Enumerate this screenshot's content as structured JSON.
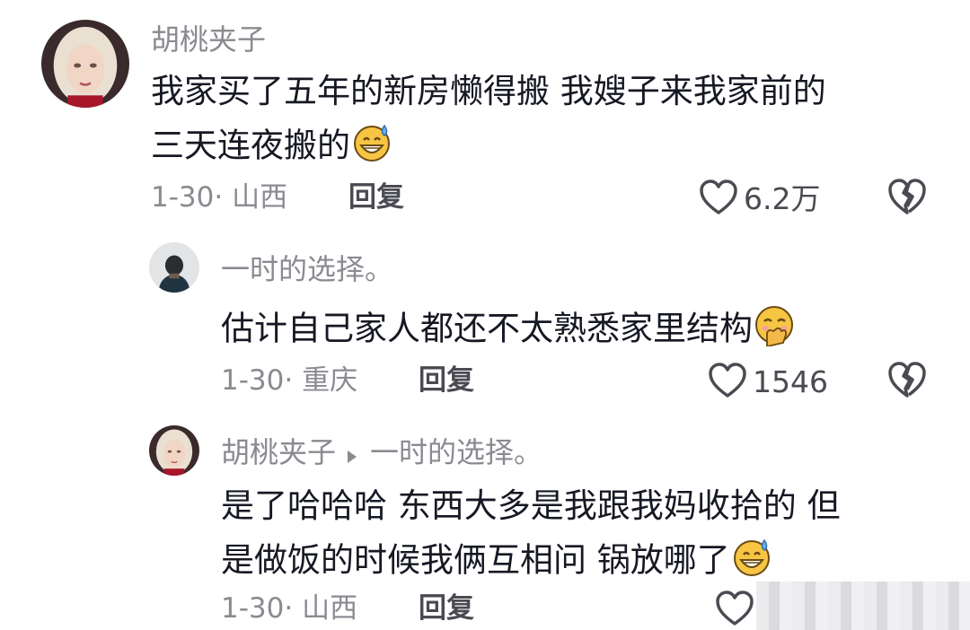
{
  "comments": [
    {
      "username": "胡桃夹子",
      "lines": [
        "我家买了五年的新房懒得搬 我嫂子来我家前的",
        "三天连夜搬的"
      ],
      "meta": "1-30· 山西",
      "reply_label": "回复",
      "likes": "6.2万",
      "avatar": "avatar-blonde-woman",
      "emoji": "grinning-sweat-emoji"
    },
    {
      "username": "一时的选择。",
      "lines": [
        "估计自己家人都还不太熟悉家里结构"
      ],
      "meta": "1-30· 重庆",
      "reply_label": "回复",
      "likes": "1546",
      "avatar": "avatar-dark-figure",
      "emoji": "hand-over-mouth-emoji"
    },
    {
      "username": "胡桃夹子",
      "reply_to": "一时的选择。",
      "lines": [
        "是了哈哈哈 东西大多是我跟我妈收拾的 但",
        "是做饭的时候我俩互相问 锅放哪了"
      ],
      "meta": "1-30· 山西",
      "reply_label": "回复",
      "avatar": "avatar-blonde-woman",
      "emoji": "grinning-sweat-emoji"
    }
  ],
  "icons": {
    "like": "heart-outline-icon",
    "dislike": "broken-heart-icon",
    "reply_arrow": "triangle-right-icon"
  },
  "colors": {
    "text": "#161823",
    "muted": "#8a8b91",
    "action": "#4a4b52"
  }
}
